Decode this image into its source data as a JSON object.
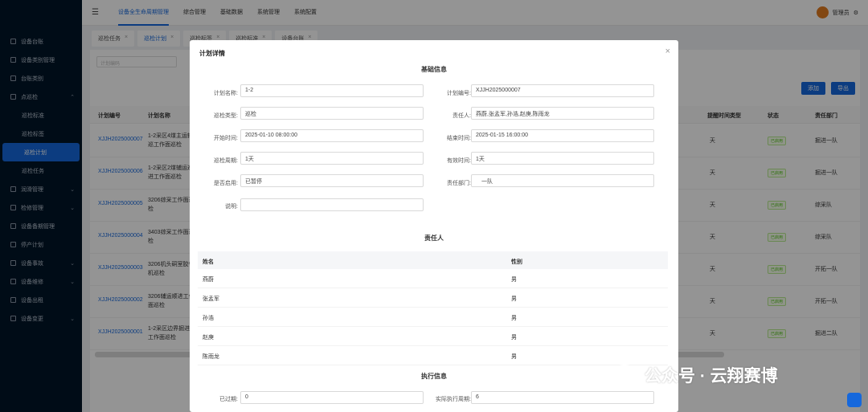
{
  "sidebar": {
    "items": [
      {
        "label": "设备台账",
        "icon": "device-icon",
        "sub": false
      },
      {
        "label": "设备类别管理",
        "icon": "category-icon",
        "sub": false
      },
      {
        "label": "台账类别",
        "icon": "ledger-icon",
        "sub": false
      },
      {
        "label": "点巡检",
        "icon": "inspection-icon",
        "sub": false,
        "expanded": true
      },
      {
        "label": "巡检标准",
        "sub": true
      },
      {
        "label": "巡检标签",
        "sub": true
      },
      {
        "label": "巡检计划",
        "sub": true,
        "active": true
      },
      {
        "label": "巡检任务",
        "sub": true
      },
      {
        "label": "润滑管理",
        "icon": "lubricate-icon",
        "sub": false,
        "collapsible": true
      },
      {
        "label": "检修管理",
        "icon": "repair-icon",
        "sub": false,
        "collapsible": true
      },
      {
        "label": "设备备期管理",
        "icon": "schedule-icon",
        "sub": false
      },
      {
        "label": "停产计划",
        "icon": "plan-icon",
        "sub": false
      },
      {
        "label": "设备事故",
        "icon": "accident-icon",
        "sub": false,
        "collapsible": true
      },
      {
        "label": "设备维修",
        "icon": "maintain-icon",
        "sub": false,
        "collapsible": true
      },
      {
        "label": "设备出租",
        "icon": "rent-icon",
        "sub": false
      },
      {
        "label": "设备变更",
        "icon": "change-icon",
        "sub": false,
        "collapsible": true
      }
    ]
  },
  "header": {
    "nav": [
      {
        "label": "设备全生命周期管理",
        "active": true
      },
      {
        "label": "综合管理"
      },
      {
        "label": "基础数据"
      },
      {
        "label": "系统管理"
      },
      {
        "label": "系统配置"
      }
    ],
    "user_name": "管理员"
  },
  "tabs": [
    {
      "label": "巡检任务"
    },
    {
      "label": "巡检计划",
      "active": true
    },
    {
      "label": "巡检标签"
    },
    {
      "label": "巡检标准"
    },
    {
      "label": "设备台账"
    }
  ],
  "main": {
    "search_placeholder": "计划编码",
    "add_label": "添加",
    "export_label": "导出",
    "columns": [
      "计划编号",
      "计划名称",
      "提醒时间类型",
      "状态",
      "责任部门"
    ],
    "rows": [
      {
        "code": "XJJH2025000007",
        "name": "1-2采区4煤主运输巡工作面巡检",
        "remind": "天",
        "status": "已启用",
        "dept": "掘进一队"
      },
      {
        "code": "XJJH2025000006",
        "name": "1-2采区2煤辅运巡进工作面巡检",
        "remind": "天",
        "status": "已启用",
        "dept": "掘进一队"
      },
      {
        "code": "XJJH2025000005",
        "name": "3206综采工作面巡检",
        "remind": "天",
        "status": "已启用",
        "dept": "综采队"
      },
      {
        "code": "XJJH2025000004",
        "name": "3403综采工作面巡检",
        "remind": "天",
        "status": "已启用",
        "dept": "综采队"
      },
      {
        "code": "XJJH2025000003",
        "name": "3206机头硐室胶带机巡检",
        "remind": "天",
        "status": "已启用",
        "dept": "开拓一队"
      },
      {
        "code": "XJJH2025000002",
        "name": "3206辅运顺进工作面巡检",
        "remind": "天",
        "status": "已启用",
        "dept": "开拓一队"
      },
      {
        "code": "XJJH2025000001",
        "name": "1-2采区边界掘进工作面巡检",
        "remind": "天",
        "status": "已启用",
        "dept": "掘进二队"
      }
    ]
  },
  "modal": {
    "title": "计划详情",
    "section_basic": "基础信息",
    "section_people": "责任人",
    "section_exec": "执行信息",
    "fields": {
      "plan_name_label": "计划名称:",
      "plan_name": "1-2",
      "plan_code_label": "计划编号:",
      "plan_code": "XJJH2025000007",
      "type_label": "巡检类型:",
      "type": "巡检",
      "owner_label": "责任人:",
      "owner": "燕蔚,张孟军,孙浩,赵庚,陈雨龙",
      "start_label": "开始时间:",
      "start": "2025-01-10 08:00:00",
      "end_label": "结束时间:",
      "end": "2025-01-15 16:00:00",
      "cycle_label": "巡检周期:",
      "cycle": "1天",
      "valid_label": "有效时间:",
      "valid": "1天",
      "enabled_label": "是否启用:",
      "enabled": "已暂停",
      "dept_label": "责任部门:",
      "dept": "一队",
      "desc_label": "说明:",
      "desc": "",
      "overdue_label": "已过期:",
      "overdue": "0",
      "actual_label": "实际执行周期:",
      "actual": "6"
    },
    "people_columns": [
      "姓名",
      "性别"
    ],
    "people": [
      {
        "name": "燕蔚",
        "gender": "男"
      },
      {
        "name": "张孟军",
        "gender": "男"
      },
      {
        "name": "孙浩",
        "gender": "男"
      },
      {
        "name": "赵庚",
        "gender": "男"
      },
      {
        "name": "陈雨龙",
        "gender": "男"
      }
    ]
  },
  "watermark": "公众号 · 云翔赛博"
}
